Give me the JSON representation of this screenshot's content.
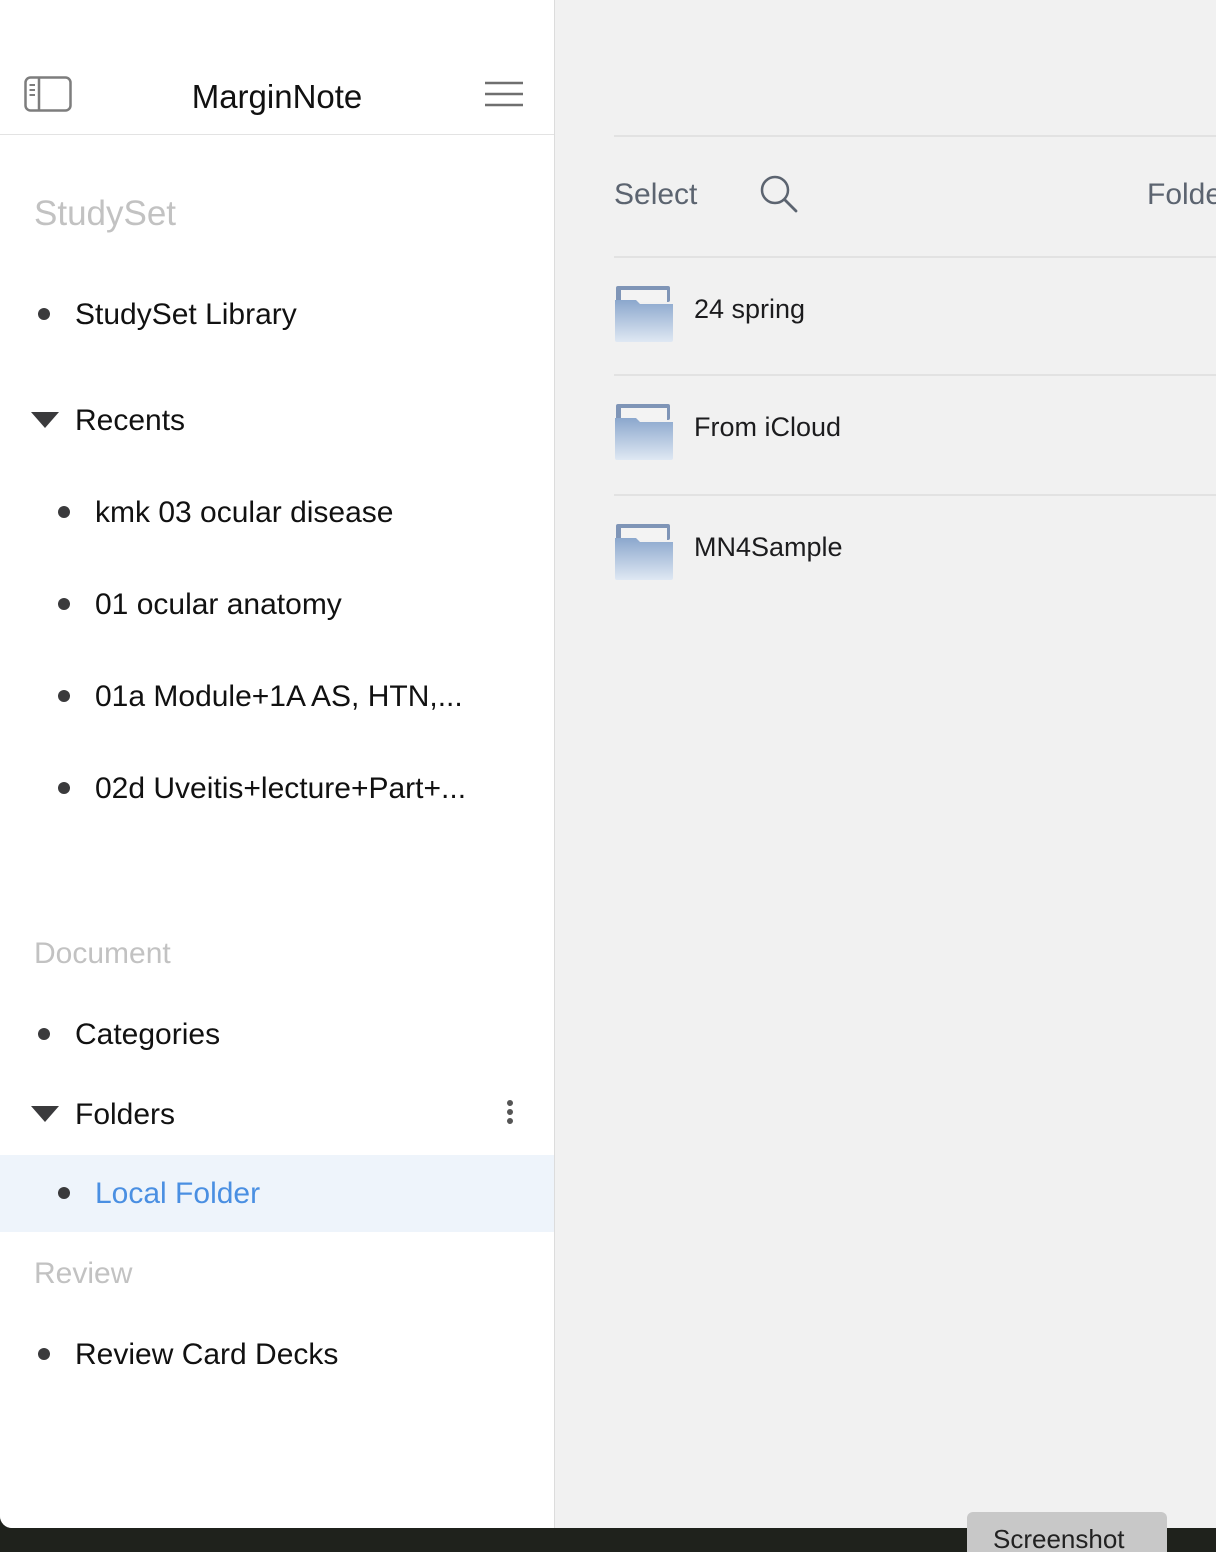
{
  "window": {
    "traffic_lights": [
      "close",
      "minimize",
      "zoom"
    ]
  },
  "sidebar": {
    "app_title": "MarginNote",
    "toggle_icon": "sidebar-toggle-icon",
    "menu_icon": "hamburger-menu-icon",
    "studyset": {
      "title": "StudySet",
      "library_label": "StudySet Library",
      "recents_label": "Recents",
      "recents": [
        "kmk 03 ocular disease",
        "01 ocular anatomy",
        "01a Module+1A AS, HTN,...",
        "02d Uveitis+lecture+Part+..."
      ]
    },
    "document": {
      "title": "Document",
      "categories_label": "Categories",
      "folders_label": "Folders",
      "selected_folder": "Local Folder"
    },
    "review": {
      "title": "Review",
      "decks_label": "Review Card Decks"
    }
  },
  "main": {
    "toolbar": {
      "select_label": "Select",
      "search_icon": "search-icon",
      "folder_label": "Folde"
    },
    "folders": [
      {
        "name": "24 spring",
        "icon": "folder-icon"
      },
      {
        "name": "From iCloud",
        "icon": "folder-icon"
      },
      {
        "name": "MN4Sample",
        "icon": "folder-icon"
      }
    ]
  },
  "taskbar": {
    "screenshot_label": "Screenshot"
  },
  "colors": {
    "accent": "#4a8fe2",
    "selected_row_bg": "#eef4fb",
    "section_title": "#c2c2c2"
  }
}
